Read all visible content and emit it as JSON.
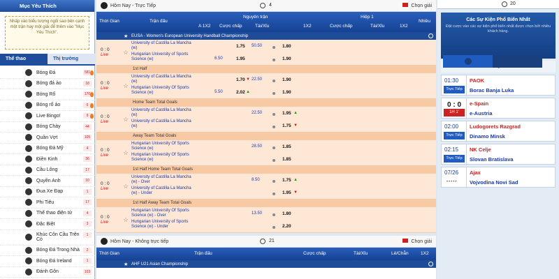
{
  "left": {
    "header": "Mục Yêu Thích",
    "fav_note": "Nhấp vào biểu tượng ngôi sao bên cạnh một trận hay một giải để thêm vào \"Mục Yêu Thích\".",
    "tabs": [
      "Thể thao",
      "Thị trường"
    ],
    "sports": [
      {
        "label": "Bóng Đá",
        "count": "581"
      },
      {
        "label": "Bóng đá ảo",
        "count": "18"
      },
      {
        "label": "Bóng Rổ",
        "count": "170"
      },
      {
        "label": "Bóng rổ ảo",
        "count": "6"
      },
      {
        "label": "Live Bingo!",
        "count": "9"
      },
      {
        "label": "Bóng Chày",
        "count": "44"
      },
      {
        "label": "Quần Vợt",
        "count": "105"
      },
      {
        "label": "Bóng Đá Mỹ",
        "count": "4"
      },
      {
        "label": "Điền Kinh",
        "count": "36"
      },
      {
        "label": "Cầu Lông",
        "count": "17"
      },
      {
        "label": "Quyền Anh",
        "count": "10"
      },
      {
        "label": "Đua Xe Đạp",
        "count": "1"
      },
      {
        "label": "Phi Tiêu",
        "count": "17"
      },
      {
        "label": "Thể thao điện tử",
        "count": "4"
      },
      {
        "label": "Đặc Biệt",
        "count": "3"
      },
      {
        "label": "Khúc Côn Cầu Trên Cỏ",
        "count": "1"
      },
      {
        "label": "Bóng Đá Trong Nhà",
        "count": "2"
      },
      {
        "label": "Bóng Đá Ireland",
        "count": "1"
      },
      {
        "label": "Đánh Gôn",
        "count": "103"
      }
    ]
  },
  "live_bar": {
    "title": "Hôm Nay - Trực Tiếp",
    "count": "4",
    "pick": "Chọn giải"
  },
  "header": {
    "time": "Thời Gian",
    "match": "Trận đấu",
    "full": "Nguyên trận",
    "half": "Hiệp 1",
    "a1x2": "A 1X2",
    "hcp": "Cược chấp",
    "ou": "Tài/Xỉu",
    "x12": "1X2",
    "h1_hcp": "Cược chấp",
    "h1_ou": "Tài/Xỉu",
    "h1_x12": "1X2",
    "more": "Nhiều"
  },
  "league": "EUSA - Women's European University Handball Championship",
  "rows": [
    {
      "score": "0 : 0",
      "status": "Live",
      "team1": "University of Castilla La Mancha (w)",
      "team2": "Hungarian University of Sports Science (w)",
      "hcp1": "",
      "hcp2": "6.50",
      "odd1": "1.75",
      "odd2": "1.95",
      "ou_line": "50.50",
      "ou1": "1.80",
      "ou2": "1.90",
      "sub": "1st Half"
    },
    {
      "score": "0 : 0",
      "status": "Live",
      "team1": "University of Castilla La Mancha (w)",
      "team2": "Hungarian University Of Sports Science (w)",
      "hcp1": "",
      "hcp2": "5.50",
      "odd1": "1.70",
      "odd2": "2.02",
      "ou_line": "22.50",
      "ou1": "1.90",
      "ou2": "1.90",
      "sub": "Home Team Total Goals"
    },
    {
      "score": "0 : 0",
      "status": "Live",
      "team1": "University of Castilla La Mancha (w)",
      "team2": "University of Castilla La Mancha (w)",
      "hcp1": "",
      "hcp2": "",
      "odd1": "",
      "odd2": "",
      "ou_line": "22.50",
      "ou1": "1.95",
      "ou2": "1.75",
      "sub": "Away Team Total Goals"
    },
    {
      "score": "0 : 0",
      "status": "Live",
      "team1": "Hungarian University Of Sports Science (w)",
      "team2": "Hungarian University Of Sports Science (w)",
      "hcp1": "",
      "hcp2": "",
      "odd1": "",
      "odd2": "",
      "ou_line": "28.50",
      "ou1": "1.85",
      "ou2": "1.85",
      "sub": "1st Half Home Team Total Goals"
    },
    {
      "score": "0 : 0",
      "status": "Live",
      "team1": "University of Castilla La Mancha (w) - Over",
      "team2": "University of Castilla La Mancha (w) - Under",
      "hcp1": "",
      "hcp2": "",
      "odd1": "",
      "odd2": "",
      "ou_line": "8.50",
      "ou1": "1.75",
      "ou2": "1.95",
      "sub": "1st Half Away Team Total Goals"
    },
    {
      "score": "0 : 0",
      "status": "Live",
      "team1": "Hungarian University Of Sports Science (w) - Over",
      "team2": "Hungarian University of Sports Science (w) - Under",
      "hcp1": "",
      "hcp2": "",
      "odd1": "",
      "odd2": "",
      "ou_line": "13.50",
      "ou1": "1.80",
      "ou2": "2.20",
      "sub": ""
    }
  ],
  "nonlive_bar": {
    "title": "Hôm Nay - Không trực tiếp",
    "count": "21",
    "pick": "Chọn giải"
  },
  "header2": {
    "time": "Thời Gian",
    "match": "Trận đấu",
    "hcp": "Cược chấp",
    "ou": "Tài/Xỉu",
    "oe": "Lẻ/Chẵn",
    "x12": "1X2",
    "more": "Nhiều"
  },
  "league2": "AHF U21 Asian Championship",
  "right": {
    "count": "20",
    "title": "Các Sự Kiện Phổ Biến Nhất",
    "desc": "Đặt cược vào các sự kiện phổ biến nhất được chọn bởi nhiều khách hàng.",
    "sport": "Bóng Đá",
    "events": [
      {
        "time": "01:30",
        "status": "Trực Tiếp",
        "t1": "PAOK",
        "t2": "Borac Banja Luka"
      },
      {
        "time": "0 : 0",
        "status": "1H 1'",
        "t1": "e-Spain",
        "t2": "e-Austria"
      },
      {
        "time": "02:00",
        "status": "Trực Tiếp",
        "t1": "Ludogorets Razgrad",
        "t2": "Dinamo Minsk"
      },
      {
        "time": "02:15",
        "status": "Trực Tiếp",
        "t1": "NK Celje",
        "t2": "Slovan Bratislava"
      },
      {
        "time": "07/26",
        "status": "",
        "t1": "Ajax",
        "t2": "Vojvodina Novi Sad"
      }
    ]
  }
}
